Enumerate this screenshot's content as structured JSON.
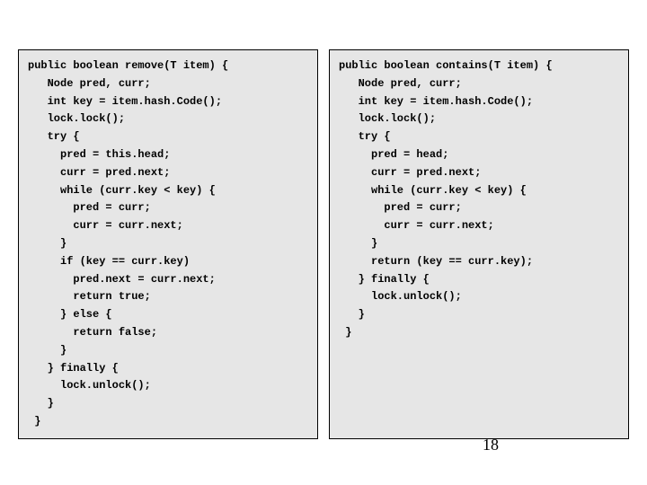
{
  "left_code": "public boolean remove(T item) {\n   Node pred, curr;\n   int key = item.hash.Code();\n   lock.lock();\n   try {\n     pred = this.head;\n     curr = pred.next;\n     while (curr.key < key) {\n       pred = curr;\n       curr = curr.next;\n     }\n     if (key == curr.key)\n       pred.next = curr.next;\n       return true;\n     } else {\n       return false;\n     }\n   } finally {\n     lock.unlock();\n   }\n }",
  "right_code": "public boolean contains(T item) {\n   Node pred, curr;\n   int key = item.hash.Code();\n   lock.lock();\n   try {\n     pred = head;\n     curr = pred.next;\n     while (curr.key < key) {\n       pred = curr;\n       curr = curr.next;\n     }\n     return (key == curr.key);\n   } finally {\n     lock.unlock();\n   }\n }",
  "page_number": "18"
}
